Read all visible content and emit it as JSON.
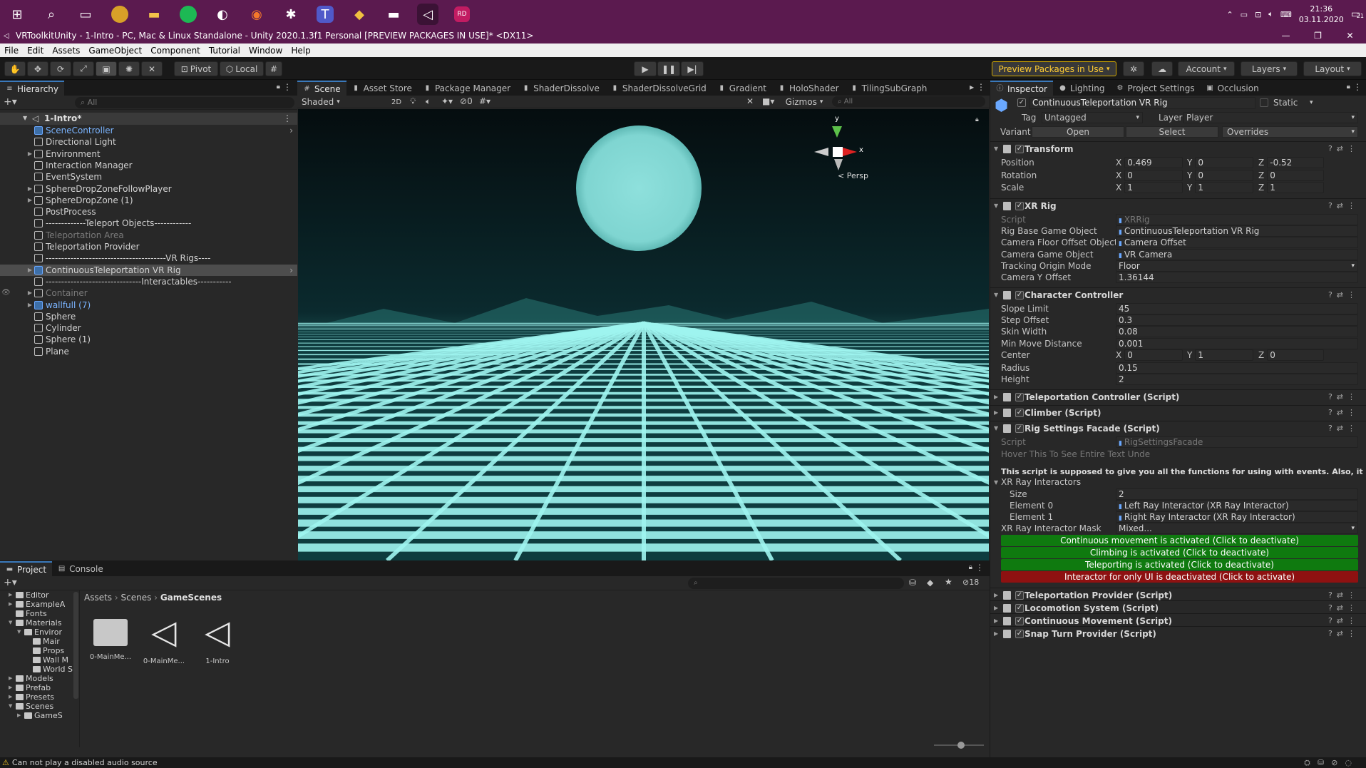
{
  "taskbar": {
    "icons": [
      "windows-start-icon",
      "search-icon",
      "task-view-icon",
      "chrome-icon",
      "file-explorer-icon",
      "spotify-icon",
      "steam-icon",
      "blender-icon",
      "slack-icon",
      "teams-icon",
      "sourcetree-icon",
      "oculus-icon",
      "unity-icon",
      "rider-icon"
    ],
    "time": "21:36",
    "date": "03.11.2020",
    "notification_count": "21"
  },
  "window": {
    "title": "VRToolkitUnity - 1-Intro - PC, Mac & Linux Standalone - Unity 2020.1.3f1 Personal [PREVIEW PACKAGES IN USE]* <DX11>"
  },
  "menu": [
    "File",
    "Edit",
    "Assets",
    "GameObject",
    "Component",
    "Tutorial",
    "Window",
    "Help"
  ],
  "toolbar": {
    "pivot": "Pivot",
    "local": "Local",
    "preview_packages": "Preview Packages in Use",
    "account": "Account",
    "layers": "Layers",
    "layout": "Layout"
  },
  "hierarchy": {
    "tab": "Hierarchy",
    "search_placeholder": "All",
    "scene": "1-Intro*",
    "items": [
      {
        "label": "SceneController",
        "style": "prefab"
      },
      {
        "label": "Directional Light",
        "style": "normal"
      },
      {
        "label": "Environment",
        "style": "normal"
      },
      {
        "label": "Interaction Manager",
        "style": "normal"
      },
      {
        "label": "EventSystem",
        "style": "normal"
      },
      {
        "label": "SphereDropZoneFollowPlayer",
        "style": "normal"
      },
      {
        "label": "SphereDropZone (1)",
        "style": "normal"
      },
      {
        "label": "PostProcess",
        "style": "normal"
      },
      {
        "label": "-------------Teleport Objects------------",
        "style": "normal"
      },
      {
        "label": "Teleportation Area",
        "style": "disabled"
      },
      {
        "label": "Teleportation Provider",
        "style": "normal"
      },
      {
        "label": "---------------------------------------VR Rigs----",
        "style": "normal"
      },
      {
        "label": "ContinuousTeleportation VR Rig",
        "style": "selected"
      },
      {
        "label": "-------------------------------Interactables-----------",
        "style": "normal"
      },
      {
        "label": "Container",
        "style": "disabled"
      },
      {
        "label": "wallfull (7)",
        "style": "prefab"
      },
      {
        "label": "Sphere",
        "style": "normal"
      },
      {
        "label": "Cylinder",
        "style": "normal"
      },
      {
        "label": "Sphere (1)",
        "style": "normal"
      },
      {
        "label": "Plane",
        "style": "normal"
      }
    ]
  },
  "scene_tabs": [
    "Scene",
    "Asset Store",
    "Package Manager",
    "ShaderDissolve",
    "ShaderDissolveGrid",
    "Gradient",
    "HoloShader",
    "TilingSubGraph"
  ],
  "scene_toolbar": {
    "shading": "Shaded",
    "mode_2d": "2D",
    "hidden_count": "0",
    "gizmos": "Gizmos",
    "search_placeholder": "All",
    "persp": "< Persp",
    "axis_y": "y",
    "axis_x": "x"
  },
  "project": {
    "tabs": [
      "Project",
      "Console"
    ],
    "tree": [
      {
        "label": "Editor",
        "depth": 1
      },
      {
        "label": "ExampleA",
        "depth": 1
      },
      {
        "label": "Fonts",
        "depth": 1
      },
      {
        "label": "Materials",
        "depth": 1
      },
      {
        "label": "Enviror",
        "depth": 2
      },
      {
        "label": "Mair",
        "depth": 3
      },
      {
        "label": "Props",
        "depth": 3
      },
      {
        "label": "Wall M",
        "depth": 3
      },
      {
        "label": "World S",
        "depth": 3
      },
      {
        "label": "Models",
        "depth": 1
      },
      {
        "label": "Prefab",
        "depth": 1
      },
      {
        "label": "Presets",
        "depth": 1
      },
      {
        "label": "Scenes",
        "depth": 1
      },
      {
        "label": "GameS",
        "depth": 2
      }
    ],
    "breadcrumb": [
      "Assets",
      "Scenes",
      "GameScenes"
    ],
    "hidden_count": "18",
    "assets": [
      {
        "label": "0-MainMe...",
        "kind": "folder"
      },
      {
        "label": "0-MainMe...",
        "kind": "unity"
      },
      {
        "label": "1-Intro",
        "kind": "unity"
      }
    ]
  },
  "inspector": {
    "tabs": [
      "Inspector",
      "Lighting",
      "Project Settings",
      "Occlusion"
    ],
    "object_name": "ContinuousTeleportation VR Rig",
    "static": "Static",
    "tag_label": "Tag",
    "tag": "Untagged",
    "layer_label": "Layer",
    "layer": "Player",
    "variant_label": "Variant",
    "open": "Open",
    "select": "Select",
    "overrides": "Overrides",
    "transform": {
      "title": "Transform",
      "position_label": "Position",
      "position": [
        "0.469",
        "0",
        "-0.52"
      ],
      "rotation_label": "Rotation",
      "rotation": [
        "0",
        "0",
        "0"
      ],
      "scale_label": "Scale",
      "scale": [
        "1",
        "1",
        "1"
      ]
    },
    "xr_rig": {
      "title": "XR Rig",
      "rows": [
        {
          "label": "Script",
          "value": "XRRig",
          "dim": true
        },
        {
          "label": "Rig Base Game Object",
          "value": "ContinuousTeleportation VR Rig"
        },
        {
          "label": "Camera Floor Offset Object",
          "value": "Camera Offset"
        },
        {
          "label": "Camera Game Object",
          "value": "VR Camera"
        },
        {
          "label": "Tracking Origin Mode",
          "value": "Floor"
        },
        {
          "label": "Camera Y Offset",
          "value": "1.36144"
        }
      ]
    },
    "character_controller": {
      "title": "Character Controller",
      "rows": [
        {
          "label": "Slope Limit",
          "value": "45"
        },
        {
          "label": "Step Offset",
          "value": "0.3"
        },
        {
          "label": "Skin Width",
          "value": "0.08"
        },
        {
          "label": "Min Move Distance",
          "value": "0.001"
        }
      ],
      "center_label": "Center",
      "center": [
        "0",
        "1",
        "0"
      ],
      "rows2": [
        {
          "label": "Radius",
          "value": "0.15"
        },
        {
          "label": "Height",
          "value": "2"
        }
      ]
    },
    "collapsed1": [
      "Teleportation Controller (Script)",
      "Climber (Script)"
    ],
    "rig_settings": {
      "title": "Rig Settings Facade (Script)",
      "script_label": "Script",
      "script": "RigSettingsFacade",
      "hover": "Hover This To See Entire Text Unde",
      "description": "This script is supposed to give you all the functions for using with events. Also, it all",
      "ray_interactors": "XR Ray Interactors",
      "size_label": "Size",
      "size": "2",
      "element0_label": "Element 0",
      "element0": "Left Ray Interactor (XR Ray Interactor)",
      "element1_label": "Element 1",
      "element1": "Right Ray Interactor (XR Ray Interactor)",
      "mask_label": "XR Ray Interactor Mask",
      "mask": "Mixed...",
      "buttons": [
        {
          "label": "Continuous movement is activated (Click to deactivate)",
          "color": "#0f7a0f"
        },
        {
          "label": "Climbing  is activated (Click to deactivate)",
          "color": "#0f7a0f"
        },
        {
          "label": "Teleporting  is activated (Click to deactivate)",
          "color": "#0f7a0f"
        },
        {
          "label": "Interactor for only UI  is deactivated (Click to activate)",
          "color": "#8e1111"
        }
      ]
    },
    "collapsed2": [
      "Teleportation Provider (Script)",
      "Locomotion System (Script)",
      "Continuous Movement (Script)",
      "Snap Turn Provider (Script)"
    ]
  },
  "status": {
    "message": "Can not play a disabled audio source"
  },
  "colors": {
    "taskbar": "#5b1a4f",
    "selection": "#2c5d87",
    "prefab_text": "#7ab4ff",
    "accent_tab": "#3a79bb"
  }
}
